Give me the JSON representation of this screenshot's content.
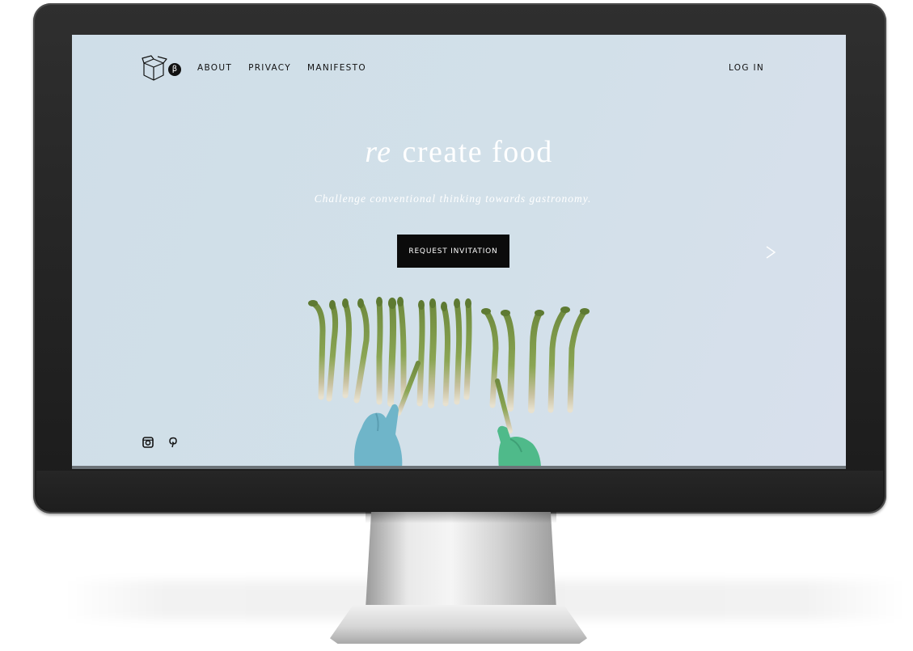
{
  "nav": {
    "items": [
      {
        "label": "ABOUT"
      },
      {
        "label": "PRIVACY"
      },
      {
        "label": "MANIFESTO"
      }
    ],
    "login": "LOG IN",
    "beta_badge": "β"
  },
  "hero": {
    "title_prefix": "re",
    "title_rest": "create food",
    "subtitle": "Challenge conventional thinking towards gastronomy.",
    "cta": "REQUEST INVITATION"
  },
  "icons": {
    "logo": "box-logo-icon",
    "next": "chevron-right-icon",
    "social": [
      "instagram-icon",
      "pinterest-icon"
    ]
  },
  "colors": {
    "screen_bg": "#d2e0e9",
    "cta_bg": "#0b0b0b",
    "hero_text": "#ffffff",
    "bezel": "#1e1e1e"
  }
}
